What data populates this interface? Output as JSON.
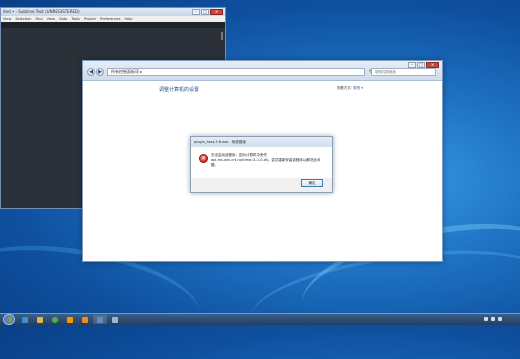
{
  "sublime": {
    "title": "ited • - Sublime Text (UNREGISTERED)",
    "menu": [
      "View",
      "Selection",
      "Find",
      "View",
      "Goto",
      "Tools",
      "Project",
      "Preferences",
      "Help"
    ],
    "btn_min": "–",
    "btn_max": "□",
    "btn_close": "✕"
  },
  "control_panel": {
    "address": "所有控制面板项 ▸",
    "search_placeholder": "搜索控制面板",
    "heading": "调整计算机的设置",
    "view_by_label": "查看方式:",
    "view_by_value": "类别 ▾",
    "btn_min": "–",
    "btn_max": "□",
    "btn_close": "✕",
    "back_glyph": "◀",
    "forward_glyph": "▶",
    "refresh_glyph": "↻"
  },
  "dialog": {
    "title": "plugin_host-3.8.exe - 系统错误",
    "message_line1": "无法启动此程序，因为计算机中丢失",
    "message_line2": "api-ms-win-crt-runtime-l1-1-0.dll。尝试重新安装该程序以解决此问",
    "message_line3": "题。",
    "ok_label": "确定",
    "icon_glyph": "✕"
  },
  "taskbar": {
    "items": [
      {
        "name": "ie",
        "color": "#3a8fe0"
      },
      {
        "name": "explorer",
        "color": "#e3b545"
      },
      {
        "name": "media-player",
        "color": "#f08a24"
      },
      {
        "name": "chrome",
        "color": "#4caf50"
      },
      {
        "name": "sublime",
        "color": "#ff9800"
      },
      {
        "name": "control-panel",
        "color": "#5b8fcf"
      },
      {
        "name": "window",
        "color": "#9fb6d1"
      }
    ],
    "clock_time": "",
    "clock_date": ""
  },
  "colors": {
    "accent": "#1e4f8a",
    "error": "#c4130a"
  }
}
